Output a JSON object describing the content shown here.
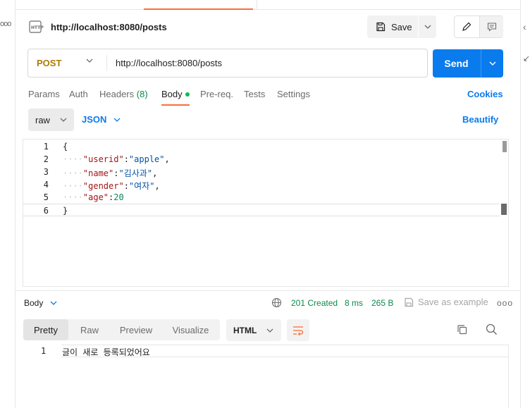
{
  "request": {
    "title": "http://localhost:8080/posts",
    "save_label": "Save",
    "method": "POST",
    "url": "http://localhost:8080/posts",
    "send_label": "Send"
  },
  "tabs": {
    "params": "Params",
    "auth": "Auth",
    "headers": "Headers",
    "headers_count": "(8)",
    "body": "Body",
    "prereq": "Pre-req.",
    "tests": "Tests",
    "settings": "Settings",
    "cookies": "Cookies"
  },
  "body_options": {
    "mode": "raw",
    "language": "JSON",
    "beautify": "Beautify"
  },
  "editor": {
    "line_numbers": [
      "1",
      "2",
      "3",
      "4",
      "5",
      "6"
    ],
    "lines": {
      "l1": "{",
      "l2_key": "\"userid\"",
      "l2_val": "\"apple\"",
      "l3_key": "\"name\"",
      "l3_val": "\"김사과\"",
      "l4_key": "\"gender\"",
      "l4_val": "\"여자\"",
      "l5_key": "\"age\"",
      "l5_val": "20",
      "l6": "}"
    },
    "current_line": 6
  },
  "response": {
    "label": "Body",
    "status": "201 Created",
    "time": "8 ms",
    "size": "265 B",
    "save_example": "Save as example",
    "views": [
      "Pretty",
      "Raw",
      "Preview",
      "Visualize"
    ],
    "active_view": "Pretty",
    "format": "HTML",
    "line_number": "1",
    "content": "글이 새로 등록되었어요"
  },
  "colors": {
    "accent": "#ff6c37",
    "send": "#097bed",
    "method": "#ad7a03",
    "status": "#0c8a4a"
  }
}
